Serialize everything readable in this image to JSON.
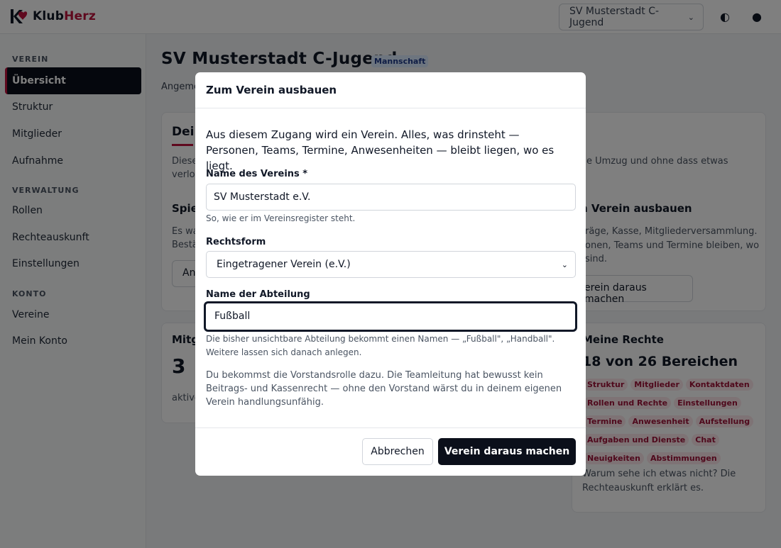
{
  "header": {
    "logo_text_a": "Klub",
    "logo_text_b": "Herz",
    "club_select": "SV Musterstadt C-Jugend",
    "icons": [
      "contrast-icon",
      "dark-mode-icon"
    ],
    "brand_color": "#be123c"
  },
  "sidebar": {
    "sections": [
      {
        "title": "VEREIN",
        "items": [
          "Übersicht",
          "Struktur",
          "Mitglieder",
          "Aufnahme"
        ]
      },
      {
        "title": "VERWALTUNG",
        "items": [
          "Rollen",
          "Rechteauskunft",
          "Einstellungen"
        ]
      },
      {
        "title": "KONTO",
        "items": [
          "Vereine",
          "Mein Konto"
        ]
      }
    ],
    "active": "Übersicht"
  },
  "main": {
    "title": "SV Musterstadt C-Jugend",
    "badge": "Mannschaft",
    "subline": "Angeme",
    "card1": {
      "title": "Dei",
      "text_a": "Diese",
      "text_b": "verlo",
      "right_text": "e Umzug und ohne dass etwas",
      "sub_title": "Spie",
      "sub_text_a": "Es wa",
      "sub_text_b": "Bestä",
      "sub_btn": "Ant",
      "upgrade_title": "n Verein ausbauen",
      "upgrade_text": [
        "räge, Kasse, Mitgliederversammlung.",
        "onen, Teams und Termine bleiben, wo",
        "sind."
      ],
      "upgrade_btn": "erein daraus machen"
    },
    "card2": {
      "title": "Mitg",
      "count": "3",
      "label": "aktive"
    },
    "rights": {
      "title": "Meine Rechte",
      "summary": "18 von 26 Bereichen",
      "chips": [
        "Struktur",
        "Mitglieder",
        "Kontaktdaten",
        "Rollen und Rechte",
        "Einstellungen",
        "Termine",
        "Anwesenheit",
        "Aufstellung",
        "Aufgaben und Dienste",
        "Chat",
        "Neuigkeiten",
        "Abstimmungen"
      ],
      "footer_a": "Warum sehe ich etwas nicht? Die",
      "footer_b": "Rechteauskunft erklärt es."
    }
  },
  "modal": {
    "title": "Zum Verein ausbauen",
    "intro": "Aus diesem Zugang wird ein Verein. Alles, was drinsteht — Personen, Teams, Termine, Anwesenheiten — bleibt liegen, wo es liegt.",
    "name_label": "Name des Vereins *",
    "name_value": "SV Musterstadt e.V.",
    "name_help": "So, wie er im Vereinsregister steht.",
    "legal_label": "Rechtsform",
    "legal_value": "Eingetragener Verein (e.V.)",
    "dept_label": "Name der Abteilung",
    "dept_value": "Fußball",
    "dept_help": "Die bisher unsichtbare Abteilung bekommt einen Namen — „Fußball\", „Handball\". Weitere lassen sich danach anlegen.",
    "note": "Du bekommst die Vorstandsrolle dazu. Die Teamleitung hat bewusst kein Beitrags- und Kassenrecht — ohne den Vorstand wärst du in deinem eigenen Verein handlungsunfähig.",
    "cancel": "Abbrechen",
    "confirm": "Verein daraus machen"
  }
}
